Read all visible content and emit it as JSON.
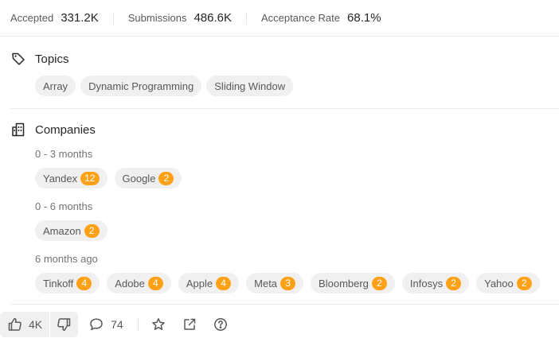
{
  "stats": {
    "accepted_label": "Accepted",
    "accepted_value": "331.2K",
    "submissions_label": "Submissions",
    "submissions_value": "486.6K",
    "acceptance_label": "Acceptance Rate",
    "acceptance_value": "68.1%"
  },
  "topics": {
    "title": "Topics",
    "icon": "tag-icon",
    "items": [
      "Array",
      "Dynamic Programming",
      "Sliding Window"
    ]
  },
  "companies": {
    "title": "Companies",
    "icon": "building-icon",
    "groups": [
      {
        "period": "0 - 3 months",
        "items": [
          {
            "name": "Yandex",
            "count": "12"
          },
          {
            "name": "Google",
            "count": "2"
          }
        ]
      },
      {
        "period": "0 - 6 months",
        "items": [
          {
            "name": "Amazon",
            "count": "2"
          }
        ]
      },
      {
        "period": "6 months ago",
        "items": [
          {
            "name": "Tinkoff",
            "count": "4"
          },
          {
            "name": "Adobe",
            "count": "4"
          },
          {
            "name": "Apple",
            "count": "4"
          },
          {
            "name": "Meta",
            "count": "3"
          },
          {
            "name": "Bloomberg",
            "count": "2"
          },
          {
            "name": "Infosys",
            "count": "2"
          },
          {
            "name": "Yahoo",
            "count": "2"
          }
        ]
      }
    ]
  },
  "footer": {
    "likes": "4K",
    "comments": "74",
    "icons": [
      "thumbs-up-icon",
      "thumbs-down-icon",
      "comment-icon",
      "star-icon",
      "share-icon",
      "help-icon"
    ]
  },
  "colors": {
    "count_badge": "#ffa116",
    "chip_bg": "#f0f0f0",
    "divider": "#ececec"
  }
}
